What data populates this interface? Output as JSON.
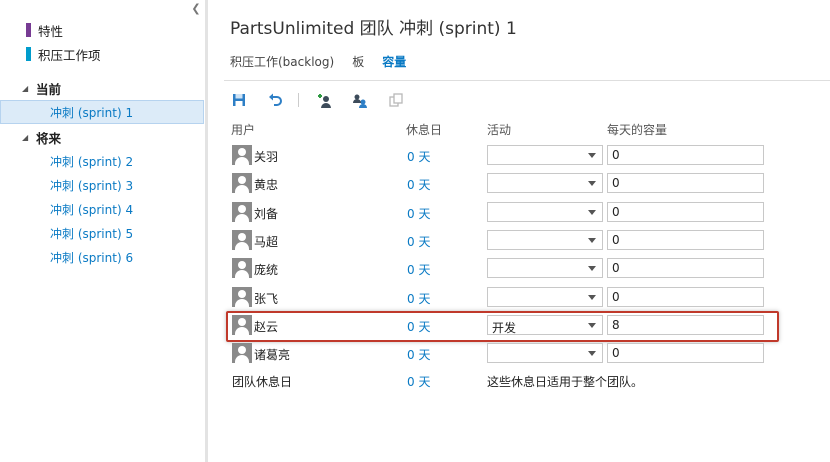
{
  "sidebar": {
    "backlog_items": [
      {
        "label": "特性",
        "color": "#773b93"
      },
      {
        "label": "积压工作项",
        "color": "#009ccc"
      }
    ],
    "current_section": "当前",
    "current_sprint": "冲刺 (sprint) 1",
    "future_section": "将来",
    "future_sprints": [
      "冲刺 (sprint) 2",
      "冲刺 (sprint) 3",
      "冲刺 (sprint) 4",
      "冲刺 (sprint) 5",
      "冲刺 (sprint) 6"
    ]
  },
  "header": {
    "title": "PartsUnlimited 团队 冲刺 (sprint) 1",
    "tabs": [
      {
        "label": "积压工作(backlog)",
        "active": false
      },
      {
        "label": "板",
        "active": false
      },
      {
        "label": "容量",
        "active": true
      }
    ]
  },
  "toolbar": {
    "icons": [
      "save-icon",
      "undo-icon",
      "add-user-icon",
      "copy-team-icon",
      "copy-icon"
    ]
  },
  "grid": {
    "columns": {
      "user": "用户",
      "days_off": "休息日",
      "activity": "活动",
      "capacity": "每天的容量"
    },
    "rows": [
      {
        "user": "关羽",
        "days_off": "0 天",
        "activity": "",
        "capacity": "0"
      },
      {
        "user": "黄忠",
        "days_off": "0 天",
        "activity": "",
        "capacity": "0"
      },
      {
        "user": "刘备",
        "days_off": "0 天",
        "activity": "",
        "capacity": "0"
      },
      {
        "user": "马超",
        "days_off": "0 天",
        "activity": "",
        "capacity": "0"
      },
      {
        "user": "庞统",
        "days_off": "0 天",
        "activity": "",
        "capacity": "0"
      },
      {
        "user": "张飞",
        "days_off": "0 天",
        "activity": "",
        "capacity": "0"
      },
      {
        "user": "赵云",
        "days_off": "0 天",
        "activity": "开发",
        "capacity": "8"
      },
      {
        "user": "诸葛亮",
        "days_off": "0 天",
        "activity": "",
        "capacity": "0"
      }
    ],
    "team_days_off_label": "团队休息日",
    "team_days_off_value": "0 天",
    "team_days_off_note": "这些休息日适用于整个团队。"
  }
}
